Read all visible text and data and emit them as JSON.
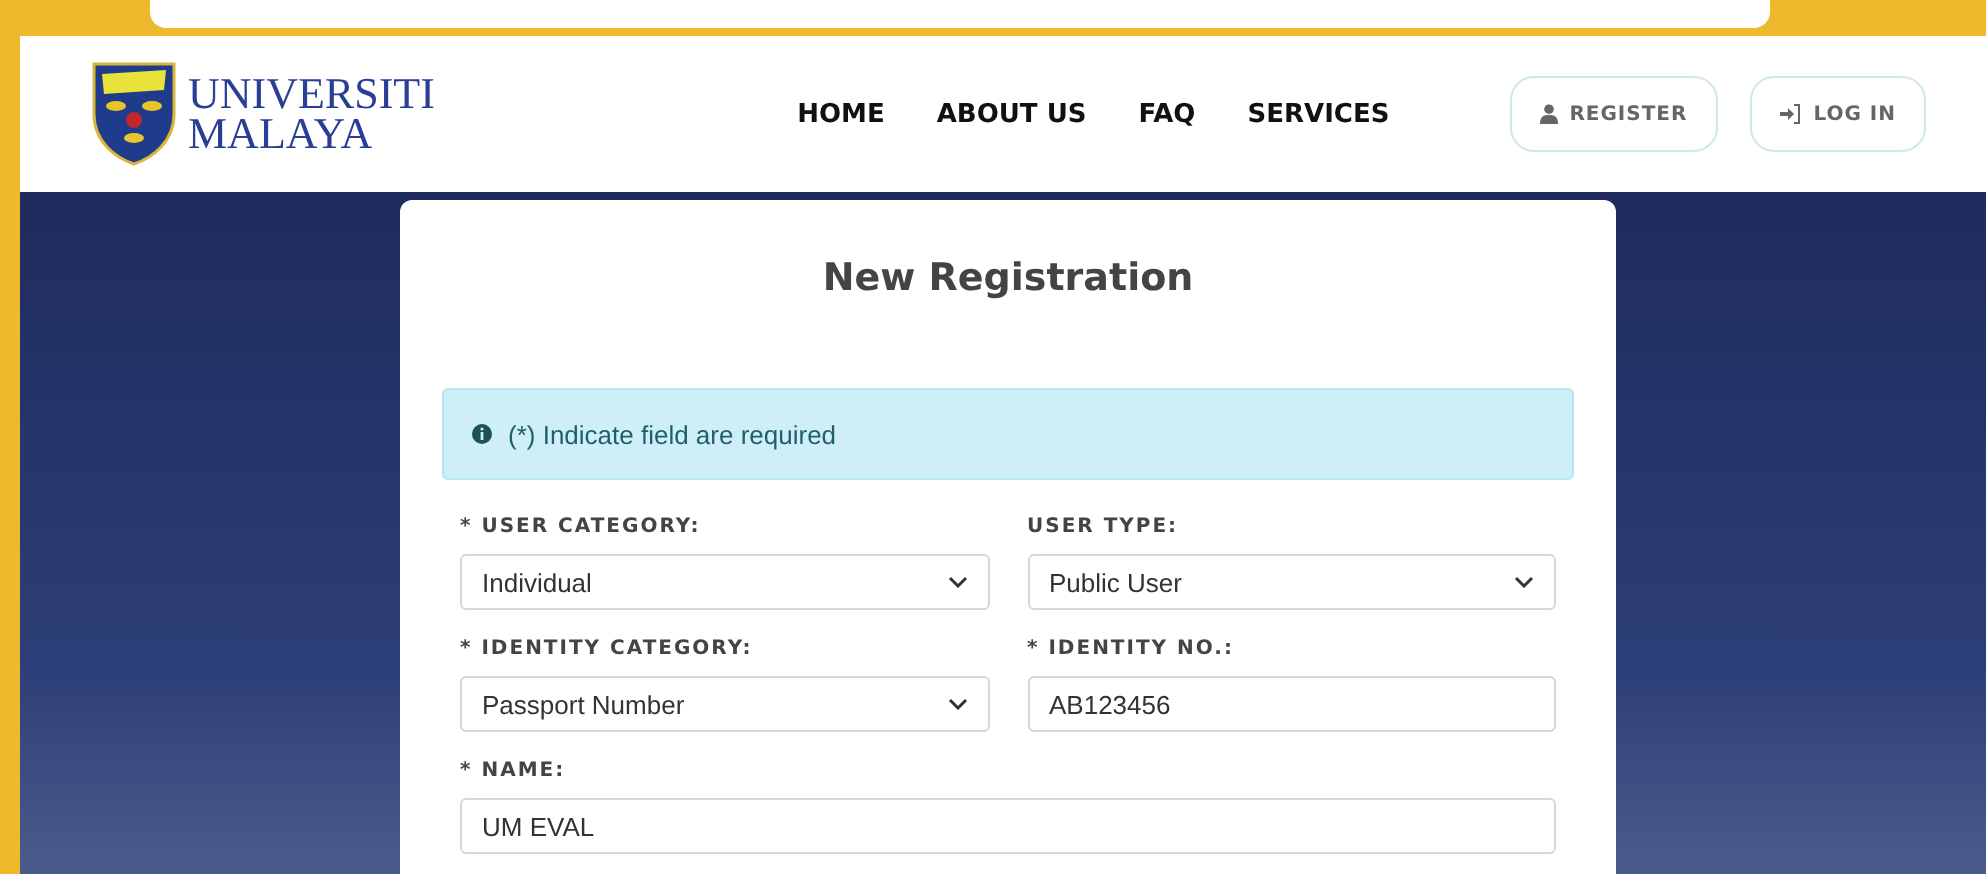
{
  "logo": {
    "line1": "UNIVERSITI",
    "line2": "MALAYA"
  },
  "nav": [
    {
      "label": "HOME"
    },
    {
      "label": "ABOUT US"
    },
    {
      "label": "FAQ"
    },
    {
      "label": "SERVICES"
    }
  ],
  "actions": [
    {
      "label": "REGISTER",
      "kind": "register"
    },
    {
      "label": "LOG IN",
      "kind": "login"
    }
  ],
  "form": {
    "title": "New Registration",
    "notice": "(*) Indicate field are required",
    "fields": [
      {
        "label": "* USER CATEGORY:",
        "kind": "select",
        "value": "Individual"
      },
      {
        "label": "USER TYPE:",
        "kind": "select",
        "value": "Public User"
      },
      {
        "label": "* IDENTITY CATEGORY:",
        "kind": "select",
        "value": "Passport Number"
      },
      {
        "label": "* IDENTITY NO.:",
        "kind": "text",
        "value": "AB123456"
      },
      {
        "label": "* NAME:",
        "kind": "text",
        "value": "UM EVAL",
        "wide": true
      }
    ]
  }
}
